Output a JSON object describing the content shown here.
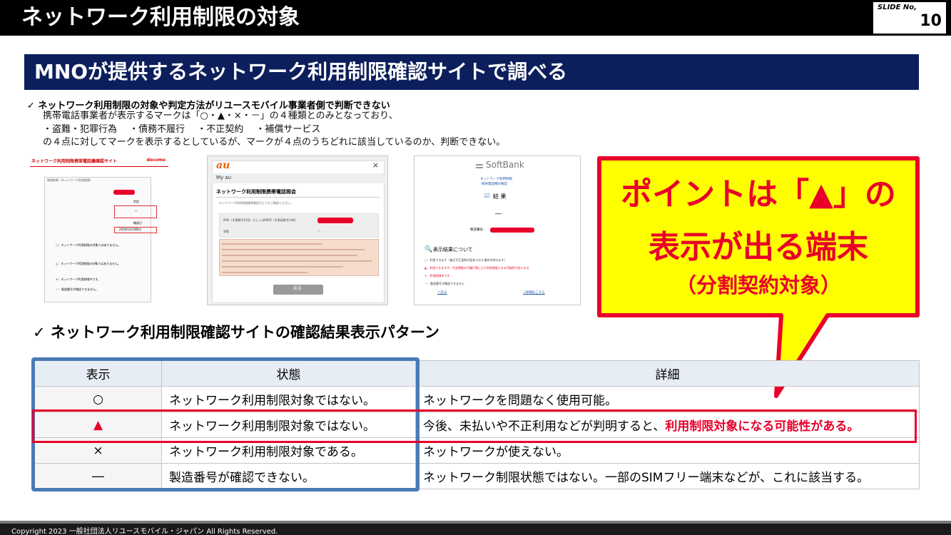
{
  "header": {
    "title": "ネットワーク利用制限の対象",
    "slide_label": "SLIDE No,",
    "slide_number": "10"
  },
  "section": {
    "title": "MNOが提供するネットワーク利用制限確認サイトで調べる"
  },
  "intro": {
    "point": "✓  ネットワーク利用制限の対象や判定方法がリユースモバイル事業者側で判断できない",
    "line1": "携帯電話事業者が表示するマークは「○・▲・×・－」の４種類とのみとなっており、",
    "line2": "・盗難・犯罪行為　 ・債務不履行　 ・不正契約　 ・補償サービス",
    "line3": "の４点に対してマークを表示するとしているが、マークが４点のうちどれに該当しているのか、判断できない。"
  },
  "screens": {
    "docomo": {
      "title": "ネットワーク利用制限携帯電話機確認サイト",
      "brand": "docomo",
      "section": "制限結果（ネットワーク利用制限）",
      "result_label": "判定",
      "result_value": "－",
      "date_label": "確認日",
      "date_value": "2020/12/10時点",
      "note1": "○：ネットワーク利用制限の対象ではありません。",
      "note2": "△：ネットワーク利用制限の対象ではありません。",
      "note3": "×：ネットワーク利用制限中です。",
      "note4": "－：製造番号が確認できません。"
    },
    "au": {
      "logo": "au",
      "close": "×",
      "menu": "My au",
      "title": "ネットワーク利用制限携帯電話照会",
      "subtitle": "ネットワーク利用制限携帯電話かどうかご確認ください。",
      "imei_label": "IMEI（半角数字15桁）もしくはMEID（半角英数字14桁）",
      "status_label": "状態",
      "status_value": "－",
      "back_button": "戻る"
    },
    "softbank": {
      "logo": "SoftBank",
      "heading1": "ネットワーク利用制限",
      "heading2": "携帯電話機の確認",
      "result_title": "結 果",
      "result_value": "―",
      "serial_label": "製造番号 :",
      "legend_title": "表示結果について",
      "legend1": "○：利用できます（後日不正契約が認められた場合を除きます）",
      "legend2": "▲：利用できますが、代金債務の不履行等により利用制限となる可能性があります",
      "legend3": "×：利用制限中です",
      "legend4": "－：製造番号が確認できません",
      "back_link": "＜戻る",
      "detail_link": "→詳細はこちら"
    }
  },
  "callout": {
    "line1": "ポイントは「▲」の",
    "line2": "表示が出る端末",
    "line3": "（分割契約対象）"
  },
  "table": {
    "heading": "✓  ネットワーク利用制限確認サイトの確認結果表示パターン",
    "headers": [
      "表示",
      "状態",
      "詳細"
    ],
    "rows": [
      {
        "mark": "○",
        "state": "ネットワーク利用制限対象ではない。",
        "detail": "ネットワークを問題なく使用可能。",
        "detail_emph": ""
      },
      {
        "mark": "▲",
        "state": "ネットワーク利用制限対象ではない。",
        "detail": "今後、未払いや不正利用などが判明すると、",
        "detail_emph": "利用制限対象になる可能性がある。"
      },
      {
        "mark": "×",
        "state": "ネットワーク利用制限対象である。",
        "detail": "ネットワークが使えない。",
        "detail_emph": ""
      },
      {
        "mark": "―",
        "state": "製造番号が確認できない。",
        "detail": "ネットワーク制限状態ではない。一部のSIMフリー端末などが、これに該当する。",
        "detail_emph": ""
      }
    ]
  },
  "footer": {
    "copyright": "Copyright 2023 一般社団法人リユースモバイル・ジャパン All Rights Reserved."
  },
  "colors": {
    "navy": "#0c1f5c",
    "red": "#e8002a",
    "yellow": "#ffff00",
    "blue_frame": "#4a7ab5"
  }
}
